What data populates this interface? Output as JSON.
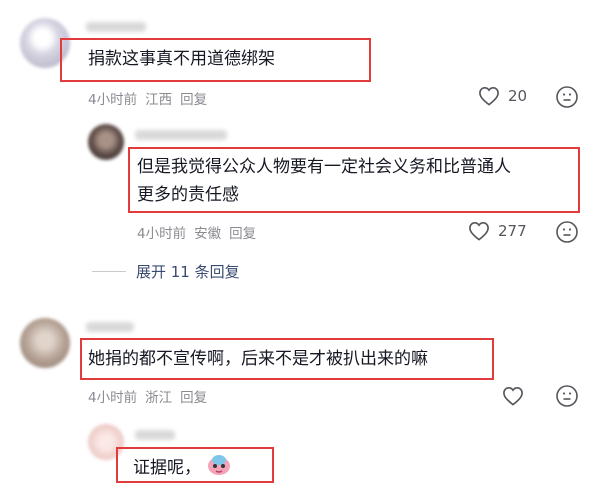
{
  "comments": [
    {
      "text": "捐款这事真不用道德绑架",
      "time": "4小时前",
      "location": "江西",
      "reply_label": "回复",
      "likes": "20",
      "avatar_color": "#c9c7d6"
    },
    {
      "text_line1": "但是我觉得公众人物要有一定社会义务和比普通人",
      "text_line2": "更多的责任感",
      "time": "4小时前",
      "location": "安徽",
      "reply_label": "回复",
      "likes": "277",
      "avatar_color": "#6d5a54"
    },
    {
      "text": "她捐的都不宣传啊，后来不是才被扒出来的嘛",
      "time": "4小时前",
      "location": "浙江",
      "reply_label": "回复",
      "likes": "",
      "avatar_color": "#b9a99d"
    },
    {
      "text": "证据呢，",
      "avatar_color": "#e8c7c5"
    }
  ],
  "expand_replies": "展开 11 条回复",
  "accent_color": "#e23b3b",
  "icons": [
    "heart-outline",
    "emoji-neutral-face",
    "cartoon-emoji-sticker"
  ]
}
